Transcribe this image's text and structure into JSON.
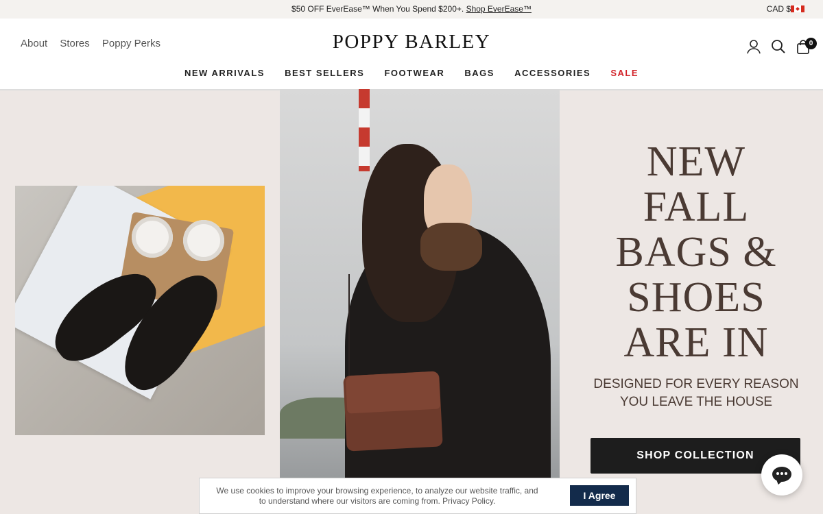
{
  "announcement": {
    "text": "$50 OFF EverEase™ When You Spend $200+.",
    "link": "Shop EverEase™",
    "currency": "CAD $"
  },
  "header": {
    "util_links": [
      "About",
      "Stores",
      "Poppy Perks"
    ],
    "logo": "POPPY BARLEY",
    "cart_count": "0",
    "nav": [
      "NEW ARRIVALS",
      "BEST SELLERS",
      "FOOTWEAR",
      "BAGS",
      "ACCESSORIES",
      "SALE"
    ]
  },
  "hero": {
    "headline_lines": [
      "NEW",
      "FALL",
      "BAGS &",
      "SHOES",
      "ARE IN"
    ],
    "sub_lines": [
      "DESIGNED FOR EVERY REASON",
      "YOU LEAVE THE HOUSE"
    ],
    "cta": "SHOP COLLECTION"
  },
  "cookie": {
    "text_line1": "We use cookies to improve your browsing experience, to analyze our website traffic, and",
    "text_line2": "to understand where our visitors are coming from.",
    "policy_link": "Privacy Policy.",
    "agree": "I Agree"
  },
  "colors": {
    "accent_sale": "#d2232a",
    "headline": "#4a3a33",
    "cta_bg": "#1d1d1d",
    "cookie_button": "#132b4b"
  },
  "icons": [
    "account-icon",
    "search-icon",
    "bag-icon",
    "chat-icon",
    "canada-flag-icon"
  ]
}
